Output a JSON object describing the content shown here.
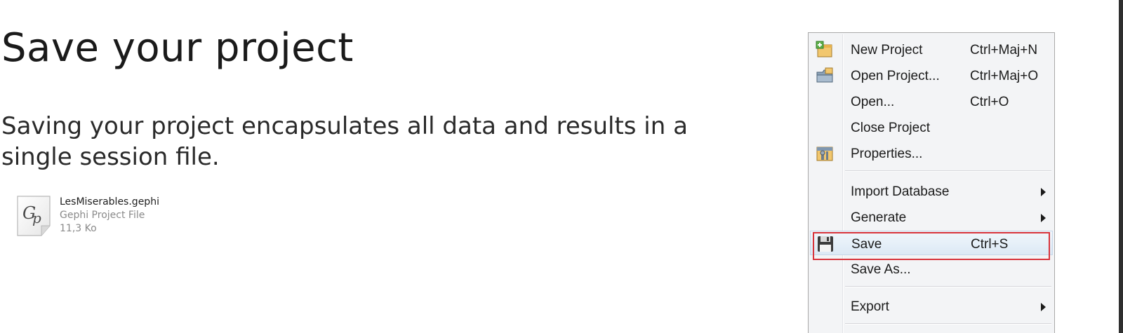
{
  "page": {
    "title": "Save your project",
    "description": "Saving your project encapsulates all data and results in a single session file."
  },
  "file": {
    "icon": "gephi-file-icon",
    "name": "LesMiserables.gephi",
    "type": "Gephi Project File",
    "size": "11,3 Ko"
  },
  "menu": {
    "items": [
      {
        "label": "New Project",
        "shortcut": "Ctrl+Maj+N",
        "icon": "new-project-icon"
      },
      {
        "label": "Open Project...",
        "shortcut": "Ctrl+Maj+O",
        "icon": "open-project-icon"
      },
      {
        "label": "Open...",
        "shortcut": "Ctrl+O"
      },
      {
        "label": "Close Project",
        "shortcut": ""
      },
      {
        "label": "Properties...",
        "shortcut": "",
        "icon": "properties-icon"
      },
      {
        "label": "Import Database",
        "shortcut": "",
        "submenu": true
      },
      {
        "label": "Generate",
        "shortcut": "",
        "submenu": true
      },
      {
        "label": "Save",
        "shortcut": "Ctrl+S",
        "icon": "save-icon",
        "highlighted": true
      },
      {
        "label": "Save As...",
        "shortcut": ""
      },
      {
        "label": "Export",
        "shortcut": "",
        "submenu": true
      }
    ]
  },
  "colors": {
    "highlight_border": "#d8333b",
    "menu_background": "#f3f4f6"
  }
}
